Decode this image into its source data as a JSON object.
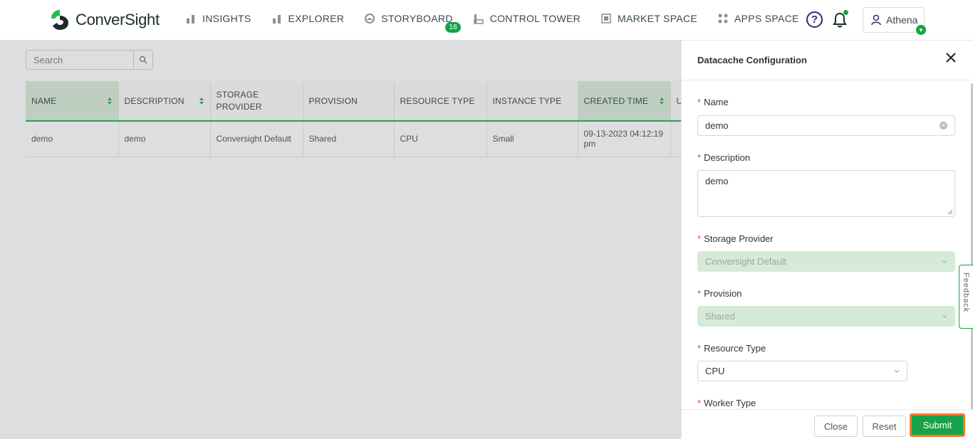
{
  "brand": {
    "name": "ConverSight"
  },
  "nav": [
    {
      "id": "insights",
      "label": "INSIGHTS",
      "icon": "bar-chart-icon"
    },
    {
      "id": "explorer",
      "label": "EXPLORER",
      "icon": "bar-chart-icon"
    },
    {
      "id": "storyboard",
      "label": "STORYBOARD",
      "icon": "storyboard-icon",
      "badge": "18"
    },
    {
      "id": "control-tower",
      "label": "CONTROL TOWER",
      "icon": "factory-icon"
    },
    {
      "id": "market-space",
      "label": "MARKET SPACE",
      "icon": "market-icon"
    },
    {
      "id": "apps-space",
      "label": "APPS SPACE",
      "icon": "apps-grid-icon"
    }
  ],
  "user": {
    "name": "Athena"
  },
  "search": {
    "placeholder": "Search"
  },
  "table": {
    "columns": [
      "NAME",
      "DESCRIPTION",
      "STORAGE PROVIDER",
      "PROVISION",
      "RESOURCE TYPE",
      "INSTANCE TYPE",
      "CREATED TIME",
      "U"
    ],
    "rows": [
      [
        "demo",
        "demo",
        "Conversight Default",
        "Shared",
        "CPU",
        "Small",
        "09-13-2023 04:12:19 pm",
        ""
      ]
    ]
  },
  "drawer": {
    "title": "Datacache Configuration",
    "fields": {
      "name": {
        "label": "Name",
        "value": "demo"
      },
      "description": {
        "label": "Description",
        "value": "demo"
      },
      "storage_provider": {
        "label": "Storage Provider",
        "value": "Conversight Default"
      },
      "provision": {
        "label": "Provision",
        "value": "Shared"
      },
      "resource_type": {
        "label": "Resource Type",
        "value": "CPU"
      },
      "worker_type": {
        "label": "Worker Type"
      }
    },
    "buttons": {
      "close": "Close",
      "reset": "Reset",
      "submit": "Submit"
    }
  },
  "feedback": {
    "label": "Feedback"
  },
  "colors": {
    "brand_green": "#15a347",
    "highlight_orange": "#f07c2a",
    "nav_dark": "#2b2f6e"
  }
}
